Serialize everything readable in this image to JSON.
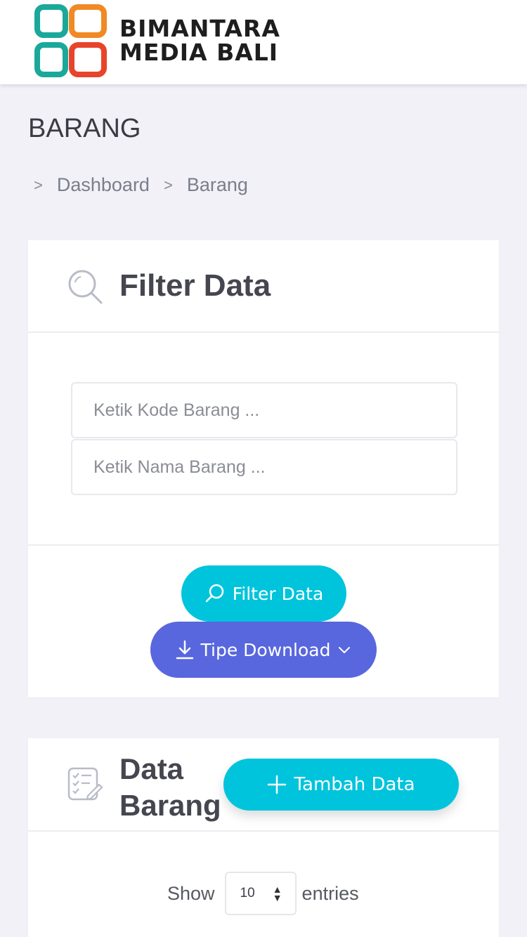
{
  "header": {
    "brand_line1": "BIMANTARA",
    "brand_line2": "MEDIA BALI",
    "logo_colors": [
      "#1aa89a",
      "#f08a24",
      "#e8442c"
    ]
  },
  "page": {
    "title": "BARANG",
    "breadcrumb": [
      "Dashboard",
      "Barang"
    ]
  },
  "filter_card": {
    "title": "Filter Data",
    "icon": "search-icon",
    "inputs": [
      {
        "placeholder": "Ketik Kode Barang ...",
        "value": ""
      },
      {
        "placeholder": "Ketik Nama Barang ...",
        "value": ""
      }
    ],
    "filter_button": "Filter Data",
    "download_button": "Tipe Download"
  },
  "data_card": {
    "title_line1": "Data",
    "title_line2": "Barang",
    "icon": "checklist-icon",
    "add_button": "Tambah Data",
    "show_label": "Show",
    "entries_value": "10",
    "entries_label": "entries"
  },
  "colors": {
    "primary": "#00c4dc",
    "accent": "#5867dd",
    "background": "#f1f1f7"
  }
}
